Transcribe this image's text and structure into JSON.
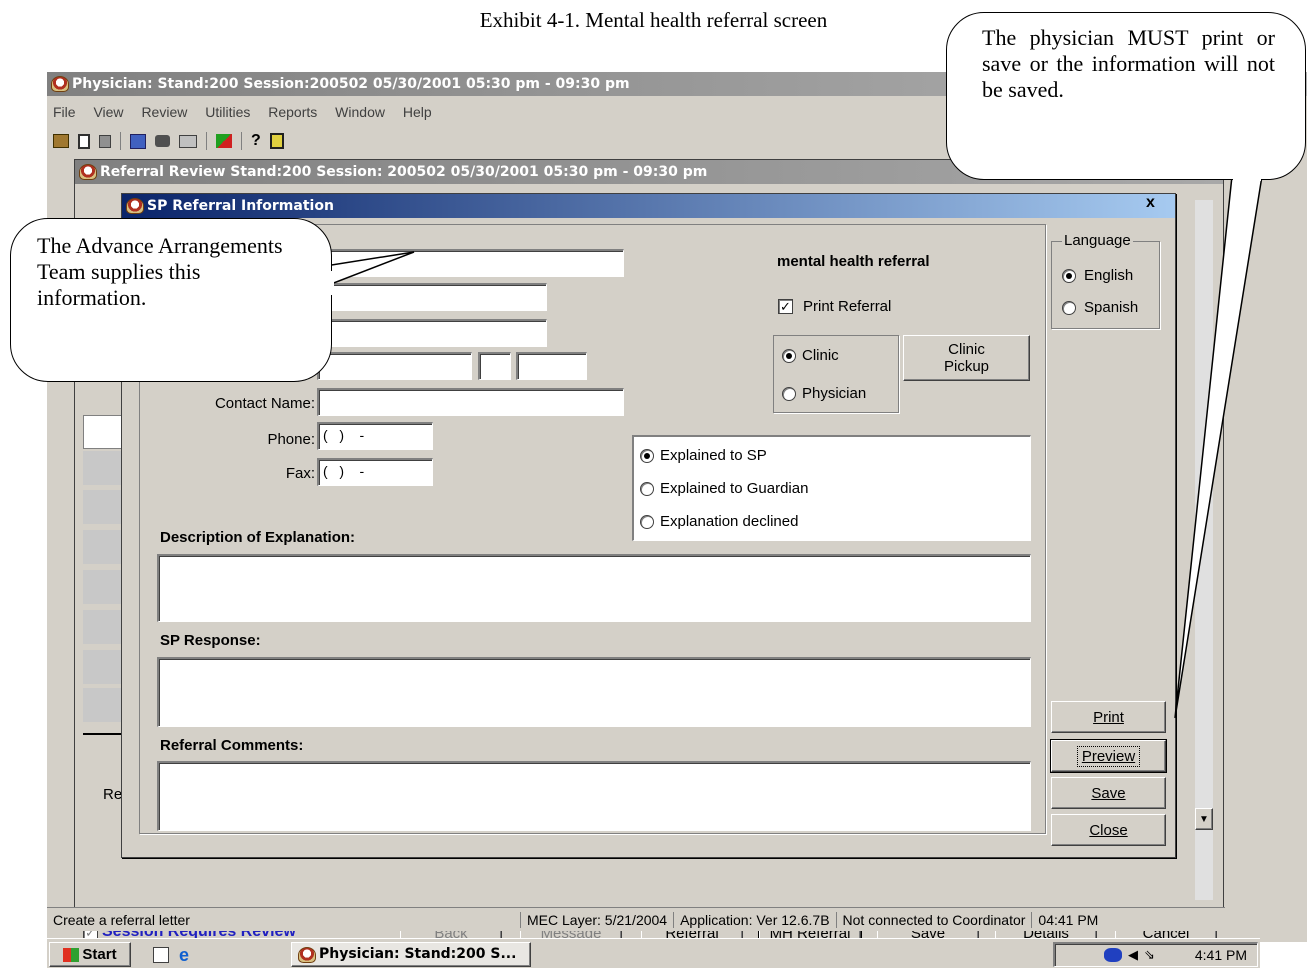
{
  "caption": "Exhibit 4-1. Mental health referral screen",
  "main_window": {
    "title": "Physician: Stand:200 Session:200502 05/30/2001 05:30 pm - 09:30 pm",
    "menu": [
      "File",
      "View",
      "Review",
      "Utilities",
      "Reports",
      "Window",
      "Help"
    ]
  },
  "referral_review": {
    "title": "Referral Review Stand:200 Session: 200502 05/30/2001 05:30 pm - 09:30 pm",
    "left_label": "Re",
    "session_requires_review": "Session Requires Review",
    "buttons": [
      "Back",
      "Message",
      "Referral",
      "MH Referral",
      "Save",
      "Details",
      "Cancel"
    ]
  },
  "dialog": {
    "title": "SP Referral Information",
    "close_glyph": "x",
    "referral_type": "mental health referral",
    "print_referral_label": "Print Referral",
    "print_referral_checked": true,
    "clinic_label": "Clinic",
    "physician_label": "Physician",
    "clinic_pickup_label": "Clinic Pickup",
    "contact_name_label": "Contact Name:",
    "phone_label": "Phone:",
    "phone_value": "(   )    -",
    "fax_label": "Fax:",
    "fax_value": "(   )    -",
    "explanation_options": [
      "Explained to SP",
      "Explained to Guardian",
      "Explanation declined"
    ],
    "description_label": "Description of Explanation:",
    "sp_response_label": "SP Response:",
    "referral_comments_label": "Referral Comments:",
    "language_group": "Language",
    "language_options": [
      "English",
      "Spanish"
    ],
    "print_button": "Print",
    "preview_button": "Preview",
    "save_button": "Save",
    "close_button": "Close"
  },
  "callouts": {
    "left": "The Advance Arrangements Team supplies this information.",
    "right": "The physician MUST print or save or the information will not be saved."
  },
  "status_bar": {
    "message": "Create a referral letter",
    "mec_layer": "MEC Layer: 5/21/2004",
    "application": "Application: Ver 12.6.7B",
    "connection": "Not connected to Coordinator",
    "time": "04:41 PM"
  },
  "taskbar": {
    "start_label": "Start",
    "task_label": "Physician: Stand:200 S...",
    "clock": "4:41 PM"
  }
}
